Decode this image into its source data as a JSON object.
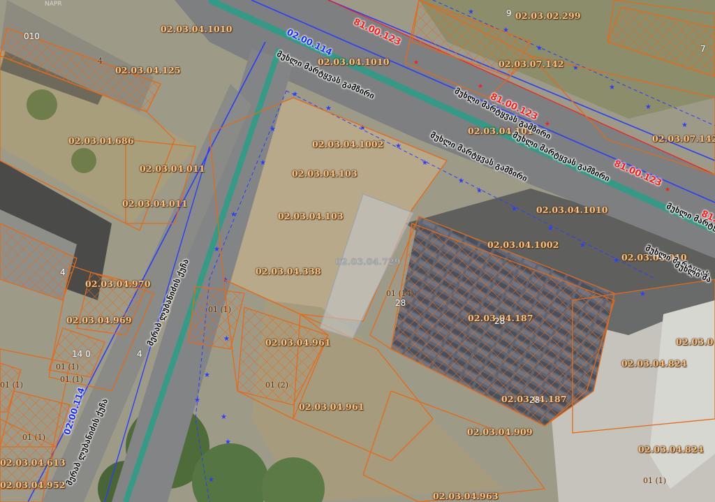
{
  "watermark": "NAPR",
  "parcels": [
    {
      "label": "02.03.04.1010"
    },
    {
      "label": "02.03.04.125"
    },
    {
      "label": "02.03.04.1010"
    },
    {
      "label": "02.03.07.142"
    },
    {
      "label": "02.03.02.299"
    },
    {
      "label": "02.03.04.101"
    },
    {
      "label": "02.03.04.1002"
    },
    {
      "label": "02.03.04.686"
    },
    {
      "label": "02.03.07.142"
    },
    {
      "label": "02.03.04.011"
    },
    {
      "label": "02.03.04.011"
    },
    {
      "label": "02.03.04.103"
    },
    {
      "label": "02.03.04.103"
    },
    {
      "label": "02.03.04.1010"
    },
    {
      "label": "02.03.04.1002"
    },
    {
      "label": "02.03.04.729"
    },
    {
      "label": "02.03.04.338"
    },
    {
      "label": "02.03.04.010"
    },
    {
      "label": "02.03.04.970"
    },
    {
      "label": "02.03.04.969"
    },
    {
      "label": "02.03.04.187"
    },
    {
      "label": "02.03.04.961"
    },
    {
      "label": "02.03.04.824"
    },
    {
      "label": "02.03.0"
    },
    {
      "label": "02.03.04.187"
    },
    {
      "label": "02.03.04.961"
    },
    {
      "label": "02.03.04.909"
    },
    {
      "label": "02.03.04.824"
    },
    {
      "label": "02.03.04.613"
    },
    {
      "label": "02.03.04.952"
    },
    {
      "label": "02.03.04.963"
    }
  ],
  "buildings": [
    {
      "label": "010"
    },
    {
      "label": "4"
    },
    {
      "label": "4"
    },
    {
      "label": "4"
    },
    {
      "label": "01 (1)"
    },
    {
      "label": "01 (14)"
    },
    {
      "label": "28"
    },
    {
      "label": "28"
    },
    {
      "label": "28"
    },
    {
      "label": "01 (2)"
    },
    {
      "label": "01 (1)"
    },
    {
      "label": "01 (1)"
    },
    {
      "label": "01 (1)"
    },
    {
      "label": "01 (1)"
    },
    {
      "label": "01 (1)"
    },
    {
      "label": "14 0"
    },
    {
      "label": "9"
    },
    {
      "label": "7"
    }
  ],
  "road_codes": [
    {
      "label": "02.00.114"
    },
    {
      "label": "02.00.114"
    },
    {
      "label": "81.00.123"
    },
    {
      "label": "81.00.123"
    },
    {
      "label": "81.00.123"
    },
    {
      "label": "81.0"
    }
  ],
  "streets": [
    {
      "label": "მუხლი მარტყვას გამზირი"
    },
    {
      "label": "მუხლი მარტყვას გამზირი"
    },
    {
      "label": "მუხლი მარტყვას გამზირი"
    },
    {
      "label": "მუხლი მარტყვას გამზირი"
    },
    {
      "label": "მუხლი მარტყვას"
    },
    {
      "label": "მუხლი მარტყვას"
    },
    {
      "label": "მუხლი მა"
    },
    {
      "label": "მერაბ ლუბანიძის ქუჩა"
    },
    {
      "label": "მერაბ ლუბანიძის ქუჩა"
    }
  ],
  "colors": {
    "parcel_boundary": "#e36a1a",
    "parcel_label": "#f2c48a",
    "municipal_road": "#2a3cff",
    "international_road": "#ff1a1a",
    "road_centerline": "#2a9d86"
  }
}
